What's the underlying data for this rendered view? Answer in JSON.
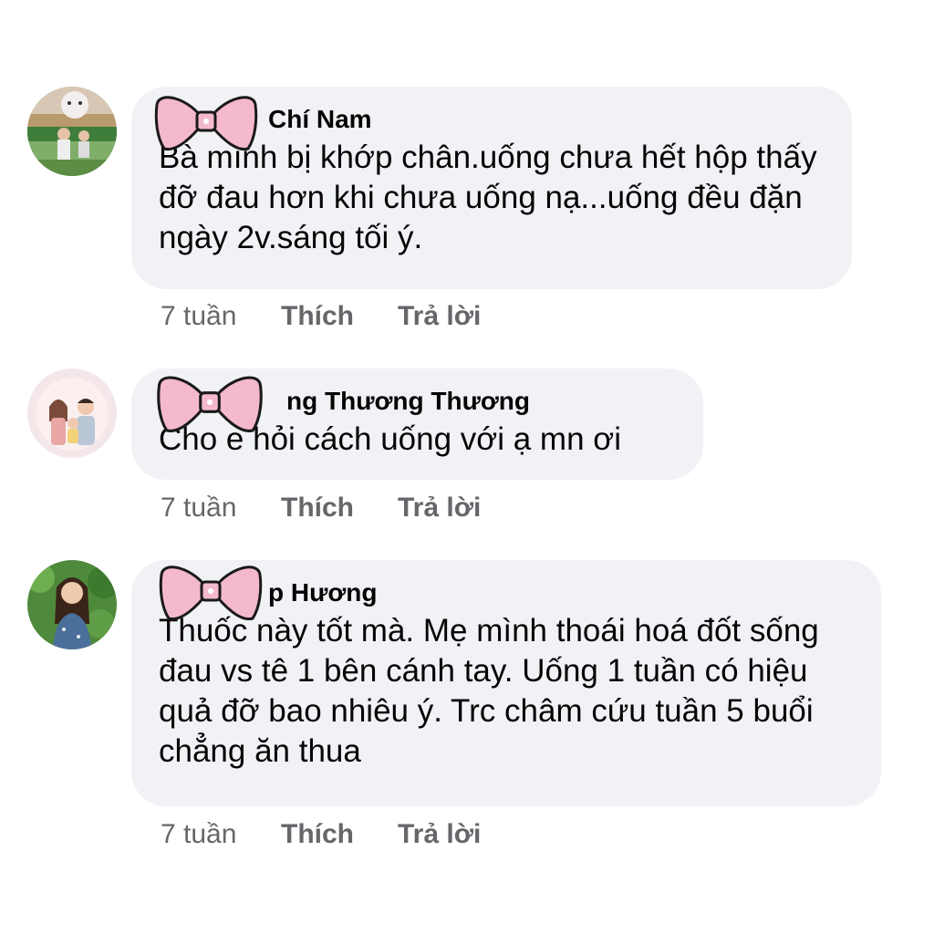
{
  "comments": [
    {
      "author": "Chí Nam",
      "text": "Bà mình bị khớp chân.uống chưa hết hộp thấy đỡ đau hơn khi chưa uống nạ...uống đều đặn ngày 2v.sáng tối ý.",
      "time": "7 tuần",
      "like": "Thích",
      "reply": "Trả lời"
    },
    {
      "author": "ng Thương Thương",
      "text": "Cho e hỏi cách uống với ạ mn ơi",
      "time": "7 tuần",
      "like": "Thích",
      "reply": "Trả lời"
    },
    {
      "author": "p Hương",
      "text": "Thuốc này tốt mà. Mẹ mình thoái hoá đốt sống đau vs tê 1 bên cánh tay. Uống 1 tuần có hiệu quả đỡ bao nhiêu ý. Trc châm cứu tuần 5 buổi chẳng ăn thua",
      "time": "7 tuần",
      "like": "Thích",
      "reply": "Trả lời"
    }
  ],
  "colors": {
    "bubble": "#f0f2f5",
    "meta": "#65676b",
    "text": "#050505",
    "bow": "#f5b9cc"
  }
}
